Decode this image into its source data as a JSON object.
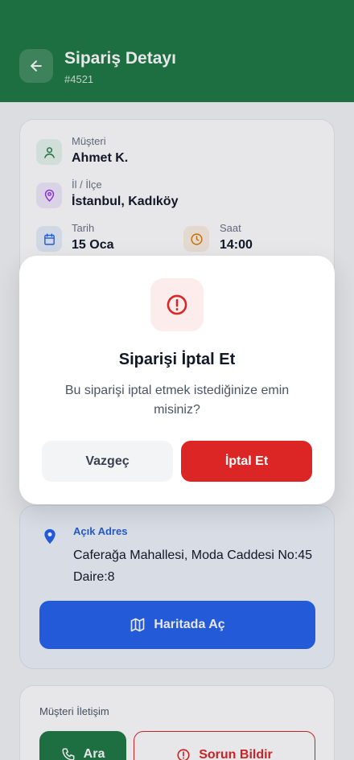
{
  "header": {
    "title": "Sipariş Detayı",
    "order_number": "#4521"
  },
  "details": {
    "customer": {
      "label": "Müşteri",
      "value": "Ahmet K."
    },
    "location": {
      "label": "İl / İlçe",
      "value": "İstanbul, Kadıköy"
    },
    "date": {
      "label": "Tarih",
      "value": "15 Oca"
    },
    "time": {
      "label": "Saat",
      "value": "14:00"
    }
  },
  "address": {
    "label": "Açık Adres",
    "text": "Caferağa Mahallesi, Moda Caddesi No:45 Daire:8",
    "map_button": "Haritada Aç"
  },
  "contact": {
    "title": "Müşteri İletişim",
    "call_button": "Ara",
    "report_button": "Sorun Bildir"
  },
  "modal": {
    "title": "Siparişi İptal Et",
    "message": "Bu siparişi iptal etmek istediğinize emin misiniz?",
    "cancel_button": "Vazgeç",
    "confirm_button": "İptal Et"
  },
  "colors": {
    "header_bg": "#1f7a45",
    "primary_blue": "#2563eb",
    "danger_red": "#dc2626"
  }
}
